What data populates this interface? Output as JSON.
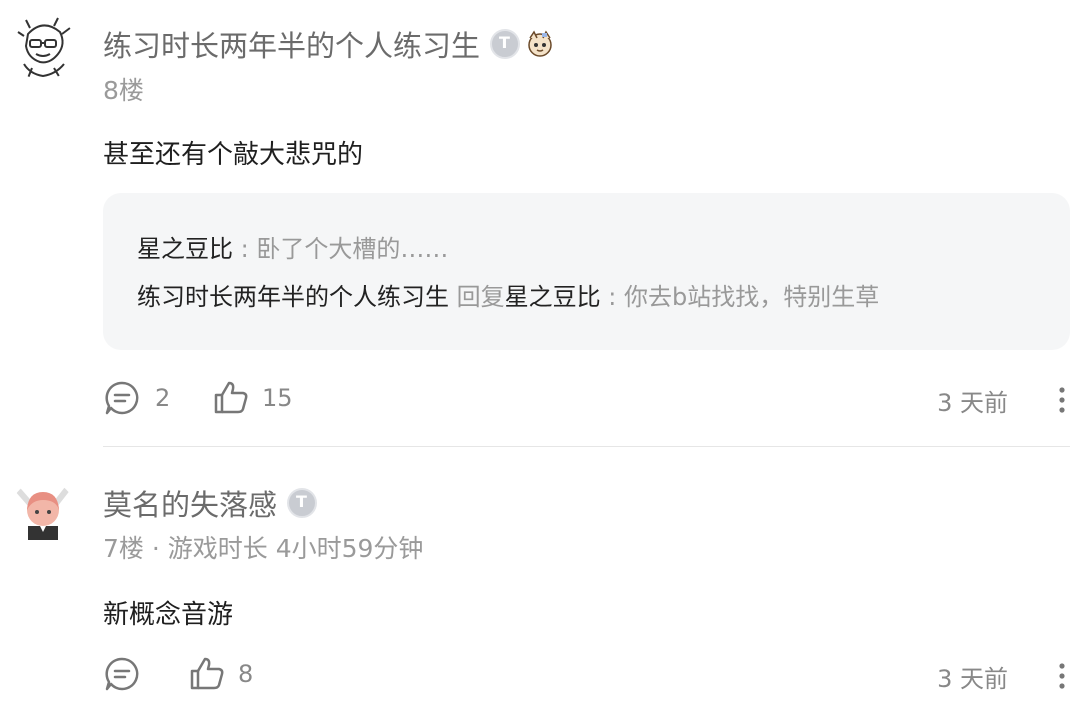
{
  "comments": [
    {
      "username": "练习时长两年半的个人练习生",
      "level_badge": "T",
      "meta": "8楼",
      "content": "甚至还有个敲大悲咒的",
      "replies": [
        {
          "name": "星之豆比",
          "separator": ":",
          "text": "卧了个大槽的……"
        },
        {
          "name": "练习时长两年半的个人练习生",
          "keyword": "回复",
          "target": "星之豆比",
          "separator": ":",
          "text": "你去b站找找，特别生草"
        }
      ],
      "reply_count": "2",
      "like_count": "15",
      "time": "3 天前"
    },
    {
      "username": "莫名的失落感",
      "level_badge": "T",
      "meta": "7楼 · 游戏时长 4小时59分钟",
      "content": "新概念音游",
      "reply_count": "",
      "like_count": "8",
      "time": "3 天前"
    }
  ],
  "icons": {
    "reply": "comment-bubble-icon",
    "like": "thumbs-up-icon",
    "more": "more-vertical-icon"
  },
  "colors": {
    "username": "#6b6b6b",
    "meta": "#9a9a9a",
    "reply_bg": "#f5f6f7"
  }
}
